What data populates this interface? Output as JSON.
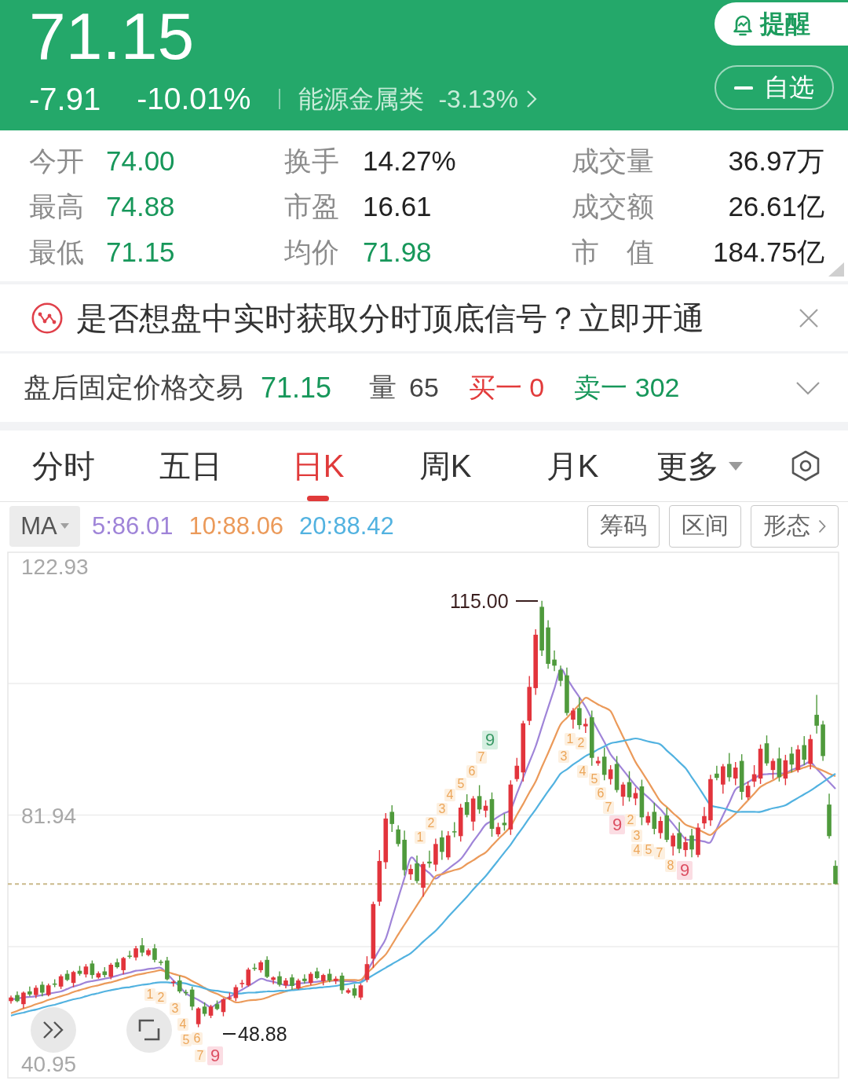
{
  "header": {
    "price": "71.15",
    "change": "-7.91",
    "change_percent": "-10.01%",
    "falling": true,
    "sector": {
      "name": "能源金属类",
      "change": "-3.13%"
    },
    "alert_button": "提醒",
    "watchlist_button": {
      "label": "自选",
      "added": true
    }
  },
  "stats": [
    {
      "label": "今开",
      "value": "74.00",
      "color": "#17975a"
    },
    {
      "label": "换手",
      "value": "14.27%",
      "color": "#222222"
    },
    {
      "label": "成交量",
      "value": "36.97万",
      "color": "#222222"
    },
    {
      "label": "最高",
      "value": "74.88",
      "color": "#17975a"
    },
    {
      "label": "市盈",
      "value": "16.61",
      "color": "#222222"
    },
    {
      "label": "成交额",
      "value": "26.61亿",
      "color": "#222222"
    },
    {
      "label": "最低",
      "value": "71.15",
      "color": "#17975a"
    },
    {
      "label": "均价",
      "value": "71.98",
      "color": "#17975a"
    },
    {
      "label": "市 值",
      "value": "184.75亿",
      "color": "#222222"
    }
  ],
  "banner": {
    "text": "是否想盘中实时获取分时顶底信号？立即开通"
  },
  "after_hours": {
    "title": "盘后固定价格交易",
    "price": "71.15",
    "price_falling": true,
    "volume_label": "量",
    "volume": "65",
    "bid": "买一 0",
    "ask": "卖一 302",
    "expanded": false
  },
  "tabs": [
    {
      "label": "分时",
      "selected": false,
      "kind": "tab"
    },
    {
      "label": "五日",
      "selected": false,
      "kind": "tab"
    },
    {
      "label": "日K",
      "selected": true,
      "kind": "tab"
    },
    {
      "label": "周K",
      "selected": false,
      "kind": "tab"
    },
    {
      "label": "月K",
      "selected": false,
      "kind": "tab"
    },
    {
      "label": "更多",
      "selected": false,
      "kind": "menu"
    }
  ],
  "indicator": {
    "name": "MA",
    "values": [
      {
        "label": "5:86.01",
        "color": "#9f84d8"
      },
      {
        "label": "10:88.06",
        "color": "#eb9a5a"
      },
      {
        "label": "20:88.42",
        "color": "#52b2e0"
      }
    ]
  },
  "tools": [
    {
      "label": "筹码",
      "kind": "plain"
    },
    {
      "label": "区间",
      "kind": "plain"
    },
    {
      "label": "形态",
      "kind": "more"
    }
  ],
  "chart": {
    "chart_data": {
      "type": "candlestick",
      "categories": [
        null,
        null,
        null,
        null,
        null,
        null,
        null,
        null,
        null,
        null,
        null,
        null,
        null,
        null,
        null,
        null,
        null,
        null,
        null,
        null,
        null,
        null,
        null,
        null,
        null,
        null,
        null,
        null,
        null,
        null,
        null,
        null,
        null,
        null,
        null,
        null,
        null,
        null,
        null,
        null,
        null,
        null,
        null,
        null,
        null,
        null,
        null,
        null,
        null,
        null,
        null,
        null,
        null,
        null,
        null,
        null,
        null,
        null,
        null,
        null,
        null,
        null,
        null,
        null,
        null,
        null,
        null,
        null,
        null,
        null,
        null,
        null,
        null,
        null,
        null,
        null,
        null,
        null,
        null,
        null,
        null,
        null,
        null,
        null,
        null,
        null,
        null,
        null,
        null,
        null,
        null,
        null,
        null,
        null,
        null,
        null,
        null,
        null,
        null,
        null,
        null,
        null,
        null,
        null,
        null,
        null,
        null,
        null,
        null,
        null,
        null,
        null,
        null,
        null,
        null,
        null,
        null,
        null,
        null,
        null,
        null,
        null,
        null,
        null,
        null,
        null,
        null,
        null,
        null,
        null,
        null,
        null,
        null
      ],
      "ylim": [
        38.75,
        125.39
      ],
      "yticks": [
        {
          "value": 122.93,
          "label": "122.93"
        },
        {
          "value": 81.94,
          "label": "81.94"
        },
        {
          "value": 40.95,
          "label": "40.95"
        }
      ],
      "ohlc": [
        [
          51.4,
          52.3,
          51.0,
          52.0
        ],
        [
          52.4,
          53.0,
          51.2,
          51.4
        ],
        [
          50.9,
          53.0,
          50.2,
          52.8
        ],
        [
          53.0,
          53.8,
          52.2,
          52.5
        ],
        [
          52.4,
          54.0,
          51.9,
          53.6
        ],
        [
          54.1,
          54.6,
          52.2,
          52.8
        ],
        [
          52.4,
          54.3,
          52.2,
          54.0
        ],
        [
          54.3,
          55.0,
          53.7,
          54.1
        ],
        [
          53.8,
          55.8,
          53.4,
          55.5
        ],
        [
          55.9,
          56.5,
          54.7,
          54.9
        ],
        [
          54.4,
          56.4,
          53.7,
          56.2
        ],
        [
          56.4,
          57.2,
          55.6,
          55.9
        ],
        [
          55.8,
          57.5,
          55.3,
          57.1
        ],
        [
          57.6,
          58.1,
          55.1,
          55.7
        ],
        [
          55.3,
          56.3,
          55.1,
          56.0
        ],
        [
          56.3,
          57.0,
          55.3,
          55.7
        ],
        [
          55.4,
          57.7,
          55.0,
          57.4
        ],
        [
          57.8,
          58.4,
          56.8,
          57.0
        ],
        [
          56.5,
          58.7,
          55.8,
          58.5
        ],
        [
          58.9,
          59.7,
          58.4,
          58.7
        ],
        [
          58.6,
          60.5,
          58.1,
          60.1
        ],
        [
          60.6,
          61.8,
          58.8,
          59.4
        ],
        [
          59.0,
          60.1,
          58.8,
          59.8
        ],
        [
          60.1,
          60.8,
          57.8,
          58.2
        ],
        [
          57.9,
          58.2,
          57.3,
          57.7
        ],
        [
          58.1,
          58.7,
          54.8,
          55.0
        ],
        [
          54.5,
          54.8,
          53.8,
          54.6
        ],
        [
          54.8,
          55.6,
          52.7,
          53.0
        ],
        [
          52.9,
          53.3,
          52.3,
          52.8
        ],
        [
          53.3,
          53.8,
          49.9,
          50.5
        ],
        [
          47.6,
          50.4,
          47.1,
          50.2
        ],
        [
          50.5,
          51.2,
          48.9,
          49.3
        ],
        [
          49.0,
          50.8,
          48.6,
          50.5
        ],
        [
          50.9,
          51.5,
          49.9,
          50.1
        ],
        [
          49.6,
          51.9,
          48.9,
          51.7
        ],
        [
          51.9,
          52.8,
          51.6,
          52.0
        ],
        [
          51.9,
          54.1,
          51.4,
          53.7
        ],
        [
          54.2,
          54.9,
          53.6,
          54.4
        ],
        [
          54.0,
          56.9,
          53.8,
          56.6
        ],
        [
          56.9,
          57.6,
          56.4,
          56.8
        ],
        [
          56.5,
          58.1,
          56.1,
          57.8
        ],
        [
          58.2,
          58.8,
          55.2,
          55.4
        ],
        [
          54.9,
          55.5,
          54.2,
          55.3
        ],
        [
          55.5,
          56.3,
          53.8,
          54.1
        ],
        [
          54.0,
          55.2,
          53.5,
          54.8
        ],
        [
          55.3,
          55.8,
          53.3,
          53.9
        ],
        [
          53.5,
          55.1,
          53.3,
          54.8
        ],
        [
          55.1,
          55.8,
          54.3,
          54.7
        ],
        [
          54.4,
          56.2,
          54.0,
          55.9
        ],
        [
          56.3,
          56.9,
          55.0,
          55.2
        ],
        [
          54.7,
          55.9,
          54.0,
          55.7
        ],
        [
          55.9,
          56.7,
          54.5,
          54.8
        ],
        [
          54.7,
          55.5,
          54.2,
          55.1
        ],
        [
          55.6,
          56.1,
          52.6,
          53.2
        ],
        [
          52.8,
          53.5,
          52.6,
          53.2
        ],
        [
          53.5,
          54.2,
          51.9,
          52.3
        ],
        [
          52.0,
          54.3,
          51.6,
          54.0
        ],
        [
          54.9,
          58.8,
          54.5,
          57.5
        ],
        [
          58.4,
          67.8,
          56.9,
          67.4
        ],
        [
          67.8,
          76.3,
          67.1,
          74.5
        ],
        [
          74.3,
          82.4,
          73.2,
          81.5
        ],
        [
          82.6,
          83.7,
          79.3,
          80.6
        ],
        [
          79.7,
          80.4,
          76.9,
          77.3
        ],
        [
          78.0,
          79.5,
          72.1,
          73.0
        ],
        [
          72.3,
          73.9,
          71.4,
          73.2
        ],
        [
          74.1,
          75.4,
          70.8,
          71.2
        ],
        [
          70.1,
          74.4,
          68.6,
          74.0
        ],
        [
          74.4,
          76.2,
          73.4,
          74.1
        ],
        [
          73.9,
          78.2,
          72.8,
          77.3
        ],
        [
          78.4,
          79.5,
          74.7,
          76.0
        ],
        [
          75.1,
          79.4,
          74.7,
          78.7
        ],
        [
          79.4,
          80.9,
          78.4,
          79.3
        ],
        [
          78.6,
          83.9,
          77.7,
          83.3
        ],
        [
          84.2,
          85.5,
          81.7,
          82.1
        ],
        [
          81.0,
          85.2,
          79.5,
          84.8
        ],
        [
          85.2,
          87.0,
          82.3,
          83.0
        ],
        [
          82.8,
          84.5,
          81.7,
          83.6
        ],
        [
          84.7,
          85.8,
          78.5,
          79.8
        ],
        [
          78.9,
          80.8,
          78.5,
          80.1
        ],
        [
          80.8,
          82.3,
          79.5,
          80.4
        ],
        [
          79.7,
          87.8,
          78.8,
          87.1
        ],
        [
          88.0,
          91.5,
          87.6,
          90.2
        ],
        [
          89.1,
          97.6,
          87.6,
          97.2
        ],
        [
          97.6,
          105.0,
          96.9,
          103.2
        ],
        [
          103.0,
          112.7,
          101.9,
          111.8
        ],
        [
          116.4,
          117.4,
          108.3,
          109.2
        ],
        [
          113.0,
          114.2,
          106.2,
          107.0
        ],
        [
          107.7,
          109.2,
          105.8,
          106.7
        ],
        [
          106.0,
          106.7,
          103.3,
          104.2
        ],
        [
          105.1,
          106.4,
          98.5,
          98.9
        ],
        [
          97.8,
          99.7,
          96.3,
          99.3
        ],
        [
          99.7,
          101.5,
          96.2,
          96.9
        ],
        [
          96.7,
          98.0,
          95.6,
          97.1
        ],
        [
          98.2,
          99.3,
          90.2,
          91.5
        ],
        [
          90.6,
          91.7,
          90.2,
          91.0
        ],
        [
          91.7,
          93.2,
          87.8,
          88.7
        ],
        [
          88.0,
          90.3,
          87.1,
          89.6
        ],
        [
          90.5,
          91.8,
          85.8,
          86.2
        ],
        [
          85.1,
          87.5,
          83.6,
          87.1
        ],
        [
          87.5,
          89.3,
          84.3,
          85.0
        ],
        [
          84.8,
          86.6,
          83.7,
          85.7
        ],
        [
          86.8,
          87.9,
          80.4,
          81.7
        ],
        [
          80.8,
          82.6,
          80.4,
          81.9
        ],
        [
          82.6,
          84.1,
          78.9,
          79.8
        ],
        [
          79.1,
          81.8,
          78.2,
          81.1
        ],
        [
          82.0,
          83.3,
          77.6,
          78.0
        ],
        [
          76.9,
          79.1,
          75.4,
          78.7
        ],
        [
          79.1,
          80.9,
          75.8,
          76.5
        ],
        [
          76.3,
          78.5,
          75.2,
          77.6
        ],
        [
          78.7,
          79.8,
          75.1,
          76.4
        ],
        [
          75.5,
          80.7,
          75.1,
          80.0
        ],
        [
          80.7,
          83.4,
          79.8,
          81.9
        ],
        [
          81.2,
          88.7,
          80.3,
          88.0
        ],
        [
          88.9,
          90.2,
          87.8,
          88.2
        ],
        [
          87.1,
          90.5,
          85.6,
          90.1
        ],
        [
          90.5,
          92.3,
          87.6,
          88.3
        ],
        [
          88.1,
          90.8,
          87.0,
          89.9
        ],
        [
          91.0,
          92.1,
          84.6,
          85.9
        ],
        [
          85.0,
          87.6,
          84.6,
          86.9
        ],
        [
          87.6,
          90.3,
          86.7,
          88.8
        ],
        [
          88.1,
          93.7,
          87.2,
          93.0
        ],
        [
          93.9,
          95.2,
          90.2,
          90.6
        ],
        [
          89.5,
          91.4,
          88.0,
          91.0
        ],
        [
          91.4,
          93.2,
          87.6,
          88.3
        ],
        [
          88.1,
          92.0,
          87.0,
          91.1
        ],
        [
          92.2,
          93.3,
          89.1,
          90.4
        ],
        [
          89.5,
          93.6,
          89.1,
          92.9
        ],
        [
          93.6,
          95.1,
          90.3,
          91.2
        ],
        [
          90.5,
          95.3,
          89.6,
          94.6
        ],
        [
          98.6,
          101.9,
          95.5,
          96.8
        ],
        [
          97.0,
          97.6,
          91.0,
          91.8
        ],
        [
          83.8,
          85.6,
          78.2,
          78.6
        ],
        [
          73.7,
          74.6,
          70.7,
          70.7
        ]
      ],
      "series": [
        {
          "type": "line",
          "color": "#9f84d8",
          "values": [
            51.7,
            51.8,
            52.0,
            52.1,
            52.2,
            52.4,
            52.6,
            52.8,
            53.0,
            53.4,
            53.8,
            54.1,
            54.5,
            54.7,
            54.9,
            55.1,
            55.3,
            55.6,
            55.9,
            56.1,
            56.4,
            56.5,
            56.7,
            56.8,
            56.9,
            55.9,
            54.8,
            53.8,
            52.7,
            52.1,
            51.6,
            51.0,
            50.4,
            51.0,
            51.6,
            52.1,
            52.7,
            53.3,
            53.9,
            54.5,
            55.1,
            54.8,
            54.6,
            54.3,
            54.0,
            54.1,
            54.3,
            54.4,
            54.5,
            54.6,
            54.7,
            54.7,
            54.8,
            54.7,
            54.7,
            54.6,
            54.5,
            56.3,
            58.1,
            59.9,
            61.7,
            65.0,
            68.4,
            71.7,
            75.0,
            74.2,
            73.3,
            72.5,
            71.6,
            72.4,
            73.2,
            74.0,
            74.8,
            76.2,
            77.7,
            79.1,
            80.5,
            81.1,
            81.8,
            82.4,
            83.0,
            85.6,
            88.2,
            90.8,
            93.4,
            96.6,
            99.8,
            102.9,
            106.1,
            104.6,
            103.0,
            101.5,
            99.9,
            97.9,
            96.0,
            94.1,
            92.1,
            90.8,
            89.5,
            88.2,
            86.9,
            85.9,
            85.0,
            84.0,
            83.0,
            81.8,
            80.6,
            79.3,
            78.1,
            78.0,
            77.9,
            77.7,
            77.6,
            79.8,
            82.0,
            84.1,
            86.3,
            86.9,
            87.5,
            88.1,
            88.7,
            88.8,
            88.9,
            88.9,
            89.0,
            89.5,
            89.9,
            90.4,
            90.8,
            89.7,
            88.6,
            87.5,
            86.4
          ]
        },
        {
          "type": "line",
          "color": "#eb9a5a",
          "values": [
            49.4,
            49.8,
            50.2,
            50.5,
            50.9,
            51.2,
            51.6,
            51.9,
            52.2,
            52.5,
            52.9,
            53.2,
            53.5,
            53.8,
            54.0,
            54.3,
            54.5,
            54.8,
            55.1,
            55.4,
            55.7,
            55.9,
            56.1,
            56.3,
            56.5,
            56.2,
            55.9,
            55.6,
            55.3,
            54.7,
            54.2,
            53.6,
            53.0,
            52.6,
            52.1,
            51.7,
            51.2,
            51.3,
            51.5,
            51.6,
            51.7,
            52.0,
            52.4,
            52.7,
            53.0,
            53.3,
            53.5,
            53.8,
            54.0,
            54.2,
            54.5,
            54.7,
            54.9,
            54.9,
            54.9,
            54.9,
            54.9,
            56.0,
            57.0,
            58.1,
            59.1,
            60.7,
            62.4,
            64.0,
            65.6,
            67.2,
            68.8,
            70.4,
            72.0,
            72.3,
            72.7,
            73.0,
            73.3,
            74.0,
            74.6,
            75.3,
            75.9,
            77.0,
            78.1,
            79.1,
            80.2,
            82.1,
            83.9,
            85.8,
            87.6,
            90.0,
            92.3,
            94.7,
            97.0,
            98.1,
            99.2,
            100.3,
            101.4,
            100.9,
            100.3,
            99.8,
            99.2,
            97.1,
            95.0,
            92.9,
            90.8,
            89.2,
            87.6,
            85.9,
            84.3,
            83.4,
            82.4,
            81.5,
            80.5,
            80.1,
            79.7,
            79.2,
            78.8,
            79.7,
            80.6,
            81.4,
            82.3,
            83.4,
            84.5,
            85.6,
            86.7,
            87.3,
            87.8,
            88.4,
            88.9,
            89.2,
            89.6,
            89.9,
            90.2,
            89.8,
            89.4,
            88.9,
            88.5
          ]
        },
        {
          "type": "line",
          "color": "#52b2e0",
          "values": [
            49.0,
            49.3,
            49.5,
            49.8,
            50.0,
            50.3,
            50.6,
            50.8,
            51.1,
            51.4,
            51.7,
            51.9,
            52.2,
            52.5,
            52.7,
            53.0,
            53.2,
            53.4,
            53.6,
            53.7,
            53.9,
            54.1,
            54.2,
            54.4,
            54.5,
            54.5,
            54.4,
            54.4,
            54.3,
            54.0,
            53.8,
            53.5,
            53.2,
            53.1,
            52.9,
            52.8,
            52.6,
            52.7,
            52.8,
            52.8,
            52.9,
            53.0,
            53.0,
            53.1,
            53.1,
            53.2,
            53.3,
            53.4,
            53.5,
            53.6,
            53.7,
            53.8,
            53.9,
            54.1,
            54.2,
            54.4,
            54.5,
            55.1,
            55.7,
            56.3,
            56.9,
            57.5,
            58.1,
            58.7,
            59.3,
            60.2,
            61.2,
            62.1,
            63.0,
            64.1,
            65.3,
            66.4,
            67.5,
            68.6,
            69.8,
            70.9,
            72.0,
            73.3,
            74.6,
            75.9,
            77.2,
            78.7,
            80.1,
            81.6,
            83.0,
            84.5,
            86.0,
            87.4,
            88.9,
            89.6,
            90.4,
            91.1,
            91.8,
            92.3,
            92.9,
            93.4,
            93.9,
            94.1,
            94.3,
            94.5,
            94.7,
            94.5,
            94.2,
            94.0,
            93.7,
            92.7,
            91.8,
            90.8,
            89.8,
            88.3,
            86.8,
            85.2,
            83.7,
            83.4,
            83.2,
            82.9,
            82.6,
            82.6,
            82.6,
            82.6,
            82.6,
            82.9,
            83.2,
            83.4,
            83.7,
            84.3,
            84.9,
            85.5,
            86.1,
            86.8,
            87.5,
            88.2,
            88.9
          ]
        }
      ]
    },
    "high_label": "115.00",
    "low_label": "48.88",
    "signals": [
      {
        "label": "1",
        "kind": "count"
      },
      {
        "label": "2",
        "kind": "count"
      },
      {
        "label": "3",
        "kind": "count"
      },
      {
        "label": "4",
        "kind": "count"
      },
      {
        "label": "5",
        "kind": "count"
      },
      {
        "label": "6",
        "kind": "count"
      },
      {
        "label": "7",
        "kind": "count"
      },
      {
        "label": "9",
        "kind": "bottom"
      },
      {
        "label": "1",
        "kind": "count"
      },
      {
        "label": "2",
        "kind": "count"
      },
      {
        "label": "3",
        "kind": "count"
      },
      {
        "label": "4",
        "kind": "count"
      },
      {
        "label": "5",
        "kind": "count"
      },
      {
        "label": "6",
        "kind": "count"
      },
      {
        "label": "7",
        "kind": "count"
      },
      {
        "label": "9",
        "kind": "top"
      },
      {
        "label": "1",
        "kind": "count"
      },
      {
        "label": "2",
        "kind": "count"
      },
      {
        "label": "3",
        "kind": "count"
      },
      {
        "label": "4",
        "kind": "count"
      },
      {
        "label": "5",
        "kind": "count"
      },
      {
        "label": "6",
        "kind": "count"
      },
      {
        "label": "7",
        "kind": "count"
      },
      {
        "label": "9",
        "kind": "bottom"
      },
      {
        "label": "2",
        "kind": "count"
      },
      {
        "label": "3",
        "kind": "count"
      },
      {
        "label": "4",
        "kind": "count"
      },
      {
        "label": "5",
        "kind": "count"
      },
      {
        "label": "7",
        "kind": "count"
      },
      {
        "label": "8",
        "kind": "count"
      },
      {
        "label": "9",
        "kind": "bottom"
      }
    ]
  }
}
